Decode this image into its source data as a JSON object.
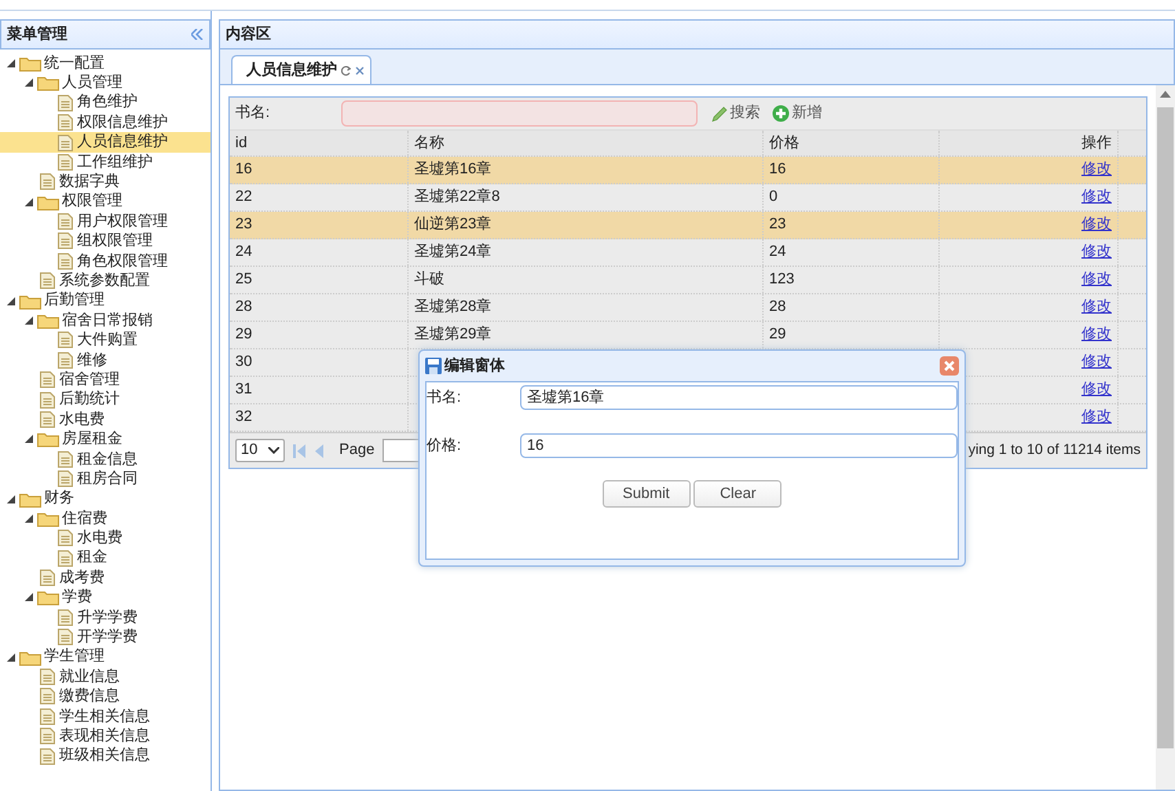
{
  "sidebar": {
    "title": "菜单管理",
    "tree": [
      {
        "label": "统一配置",
        "kind": "folder",
        "expanded": true,
        "selected": false,
        "children": [
          {
            "label": "人员管理",
            "kind": "folder",
            "expanded": true,
            "selected": false,
            "children": [
              {
                "label": "角色维护",
                "kind": "file",
                "selected": false
              },
              {
                "label": "权限信息维护",
                "kind": "file",
                "selected": false
              },
              {
                "label": "人员信息维护",
                "kind": "file",
                "selected": true
              },
              {
                "label": "工作组维护",
                "kind": "file",
                "selected": false
              }
            ]
          },
          {
            "label": "数据字典",
            "kind": "file",
            "selected": false
          },
          {
            "label": "权限管理",
            "kind": "folder",
            "expanded": true,
            "selected": false,
            "children": [
              {
                "label": "用户权限管理",
                "kind": "file",
                "selected": false
              },
              {
                "label": "组权限管理",
                "kind": "file",
                "selected": false
              },
              {
                "label": "角色权限管理",
                "kind": "file",
                "selected": false
              }
            ]
          },
          {
            "label": "系统参数配置",
            "kind": "file",
            "selected": false
          }
        ]
      },
      {
        "label": "后勤管理",
        "kind": "folder",
        "expanded": true,
        "selected": false,
        "children": [
          {
            "label": "宿舍日常报销",
            "kind": "folder",
            "expanded": true,
            "selected": false,
            "children": [
              {
                "label": "大件购置",
                "kind": "file",
                "selected": false
              },
              {
                "label": "维修",
                "kind": "file",
                "selected": false
              }
            ]
          },
          {
            "label": "宿舍管理",
            "kind": "file",
            "selected": false
          },
          {
            "label": "后勤统计",
            "kind": "file",
            "selected": false
          },
          {
            "label": "水电费",
            "kind": "file",
            "selected": false
          },
          {
            "label": "房屋租金",
            "kind": "folder",
            "expanded": true,
            "selected": false,
            "children": [
              {
                "label": "租金信息",
                "kind": "file",
                "selected": false
              },
              {
                "label": "租房合同",
                "kind": "file",
                "selected": false
              }
            ]
          }
        ]
      },
      {
        "label": "财务",
        "kind": "folder",
        "expanded": true,
        "selected": false,
        "children": [
          {
            "label": "住宿费",
            "kind": "folder",
            "expanded": true,
            "selected": false,
            "children": [
              {
                "label": "水电费",
                "kind": "file",
                "selected": false
              },
              {
                "label": "租金",
                "kind": "file",
                "selected": false
              }
            ]
          },
          {
            "label": "成考费",
            "kind": "file",
            "selected": false
          },
          {
            "label": "学费",
            "kind": "folder",
            "expanded": true,
            "selected": false,
            "children": [
              {
                "label": "升学学费",
                "kind": "file",
                "selected": false
              },
              {
                "label": "开学学费",
                "kind": "file",
                "selected": false
              }
            ]
          }
        ]
      },
      {
        "label": "学生管理",
        "kind": "folder",
        "expanded": true,
        "selected": false,
        "children": [
          {
            "label": "就业信息",
            "kind": "file",
            "selected": false
          },
          {
            "label": "缴费信息",
            "kind": "file",
            "selected": false
          },
          {
            "label": "学生相关信息",
            "kind": "file",
            "selected": false
          },
          {
            "label": "表现相关信息",
            "kind": "file",
            "selected": false
          },
          {
            "label": "班级相关信息",
            "kind": "file",
            "selected": false
          }
        ]
      }
    ]
  },
  "content": {
    "title": "内容区",
    "tabs": [
      {
        "label": "人员信息维护",
        "selected": true
      }
    ]
  },
  "toolbar": {
    "label": "书名:",
    "buttons": [
      {
        "label": "搜索",
        "kind": "search"
      },
      {
        "label": "新增",
        "kind": "add"
      }
    ]
  },
  "table": {
    "columns": [
      "id",
      "名称",
      "价格",
      "操作"
    ],
    "rows": [
      {
        "id": "16",
        "name": "圣墟第16章",
        "price": "16",
        "action": "修改",
        "selected": true
      },
      {
        "id": "22",
        "name": "圣墟第22章8",
        "price": "0",
        "action": "修改",
        "selected": false
      },
      {
        "id": "23",
        "name": "仙逆第23章",
        "price": "23",
        "action": "修改",
        "selected": true
      },
      {
        "id": "24",
        "name": "圣墟第24章",
        "price": "24",
        "action": "修改",
        "selected": false
      },
      {
        "id": "25",
        "name": "斗破",
        "price": "123",
        "action": "修改",
        "selected": false
      },
      {
        "id": "28",
        "name": "圣墟第28章",
        "price": "28",
        "action": "修改",
        "selected": false
      },
      {
        "id": "29",
        "name": "圣墟第29章",
        "price": "29",
        "action": "修改",
        "selected": false
      },
      {
        "id": "30",
        "action": "修改",
        "selected": false
      },
      {
        "id": "31",
        "action": "修改",
        "selected": false
      },
      {
        "id": "32",
        "action": "修改",
        "selected": false
      }
    ]
  },
  "pager": {
    "page_size": "10",
    "page_label": "Page",
    "summary": "ying 1 to 10 of 11214 items"
  },
  "dialog": {
    "title": "编辑窗体",
    "fields": [
      {
        "label": "书名:",
        "value": "圣墟第16章"
      },
      {
        "label": "价格:",
        "value": "16"
      }
    ],
    "buttons": [
      "Submit",
      "Clear"
    ]
  }
}
